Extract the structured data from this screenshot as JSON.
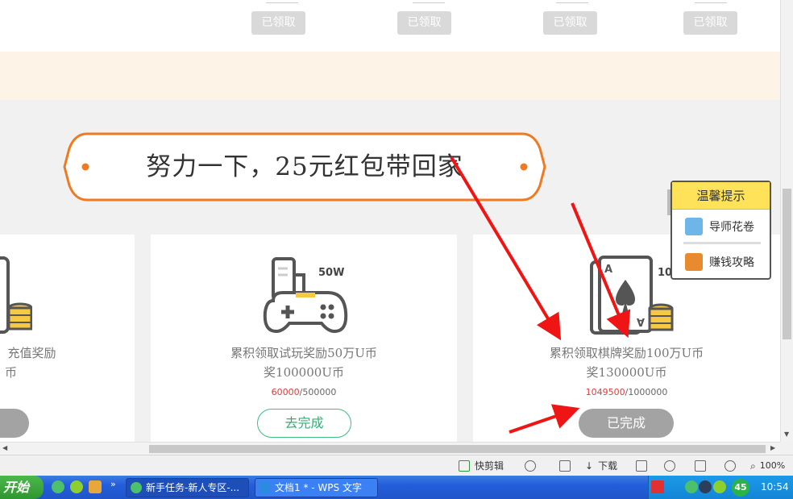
{
  "top_section": {
    "claimed_buttons": [
      "已领取",
      "已领取",
      "已领取",
      "已领取"
    ]
  },
  "banner": {
    "title": "努力一下，25元红包带回家"
  },
  "cards": [
    {
      "desc_line1": "充值奖励",
      "desc_line2": "币"
    },
    {
      "badge": "50W",
      "desc_line1": "累积领取试玩奖励50万U币",
      "desc_line2": "奖100000U币",
      "progress_current": "60000",
      "progress_total": "/500000",
      "action_label": "去完成"
    },
    {
      "badge": "10",
      "desc_line1": "累积领取棋牌奖励100万U币",
      "desc_line2": "奖130000U币",
      "progress_current": "1049500",
      "progress_total": "/1000000",
      "action_label": "已完成",
      "card_letter": "A"
    }
  ],
  "tips_popup": {
    "title": "温馨提示",
    "items": [
      {
        "label": "导师花卷",
        "icon": "qq-penguin-icon"
      },
      {
        "label": "赚钱攻略",
        "icon": "money-bag-icon"
      }
    ]
  },
  "statusbar": {
    "quick_clip": "快剪辑",
    "download": "下载",
    "zoom": "100%"
  },
  "taskbar": {
    "start_label": "开始",
    "tasks": [
      {
        "label": "新手任务-新人专区-...",
        "icon": "ie-browser-icon"
      },
      {
        "label": "文档1 * - WPS 文字",
        "icon": "wps-writer-icon"
      }
    ],
    "tray_badge": "45",
    "clock": "10:54"
  },
  "colors": {
    "banner_orange": "#f07a22",
    "go_green": "#2fb070",
    "progress_red": "#e03a3a",
    "tips_yellow": "#fde25a",
    "annotation_red": "#f01515"
  }
}
